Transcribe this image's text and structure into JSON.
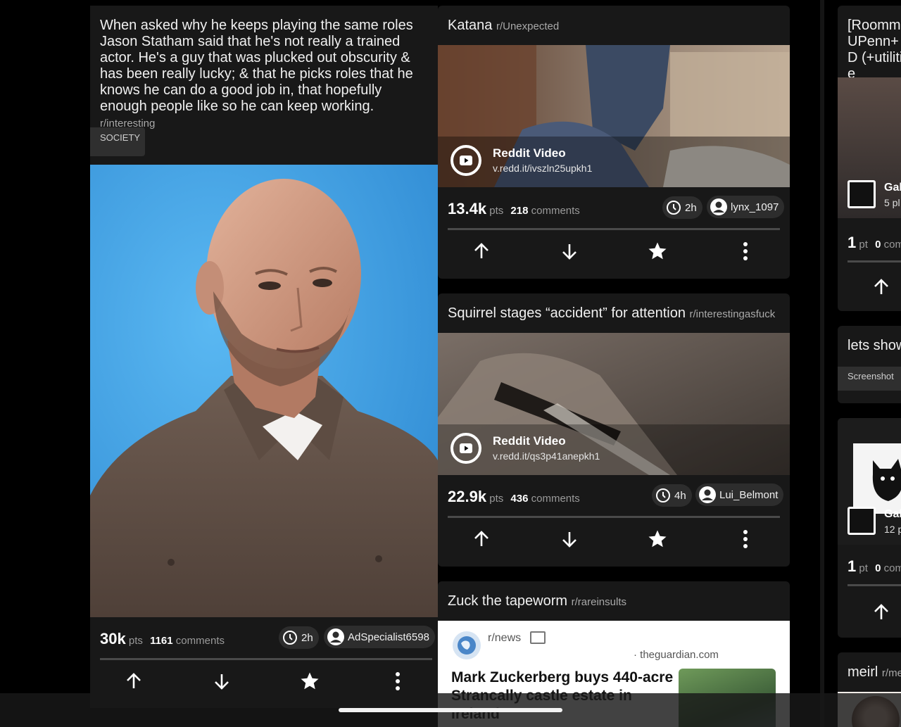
{
  "post1": {
    "title": "When asked why he keeps playing the same roles Jason Statham said that he's not really a trained actor. He's a guy that was plucked out obscurity & has been really lucky; & that he picks roles that he knows he can do a good job in, that hopefully enough people like so he can keep working.",
    "subreddit": "r/interesting",
    "flair": "SOCIETY",
    "points": "30k",
    "points_unit": "pts",
    "comments": "1161",
    "comments_label": "comments",
    "age": "2h",
    "author": "AdSpecialist6598"
  },
  "post2": {
    "title": "Katana",
    "subreddit": "r/Unexpected",
    "video_title": "Reddit Video",
    "video_url": "v.redd.it/ivszln25upkh1",
    "points": "13.4k",
    "points_unit": "pts",
    "comments": "218",
    "comments_label": "comments",
    "age": "2h",
    "author": "lynx_1097"
  },
  "post3": {
    "title": "Squirrel stages “accident” for attention",
    "subreddit": "r/interestingasfuck",
    "video_title": "Reddit Video",
    "video_url": "v.redd.it/qs3p41anepkh1",
    "points": "22.9k",
    "points_unit": "pts",
    "comments": "436",
    "comments_label": "comments",
    "age": "4h",
    "author": "Lui_Belmont"
  },
  "post4": {
    "title": "Zuck the tapeworm",
    "subreddit": "r/rareinsults",
    "embed": {
      "source_sub": "r/news",
      "domain": "· theguardian.com",
      "headline": "Mark Zuckerberg buys 440-acre Strancally castle estate in Ireland"
    }
  },
  "right_column": {
    "post_a_title": "[Roomm UPenn+D (+utilitie",
    "post_a_gallery_label": "Gal",
    "post_a_gallery_count": "5 pl",
    "post_a_points": "1",
    "post_a_points_unit": "pt",
    "post_a_comments": "0",
    "post_a_comments_label": "com",
    "post_b_title": "lets show",
    "post_b_flair": "Screenshot",
    "post_c_gallery_label": "Gal",
    "post_c_gallery_count": "12 p",
    "post_c_points": "1",
    "post_c_points_unit": "pt",
    "post_c_comments": "0",
    "post_c_comments_label": "com",
    "post_d_title": "meirl",
    "post_d_subreddit": "r/me"
  },
  "colors": {
    "background": "#000000",
    "card": "#181818",
    "chip": "#2d2d2d",
    "muted_text": "#9a9a9a",
    "photo_backdrop": "#3fa2e6"
  },
  "icons": [
    "clock-icon",
    "user-icon",
    "play-icon",
    "upvote-icon",
    "downvote-icon",
    "star-icon",
    "more-icon",
    "gallery-icon",
    "globe-icon"
  ]
}
